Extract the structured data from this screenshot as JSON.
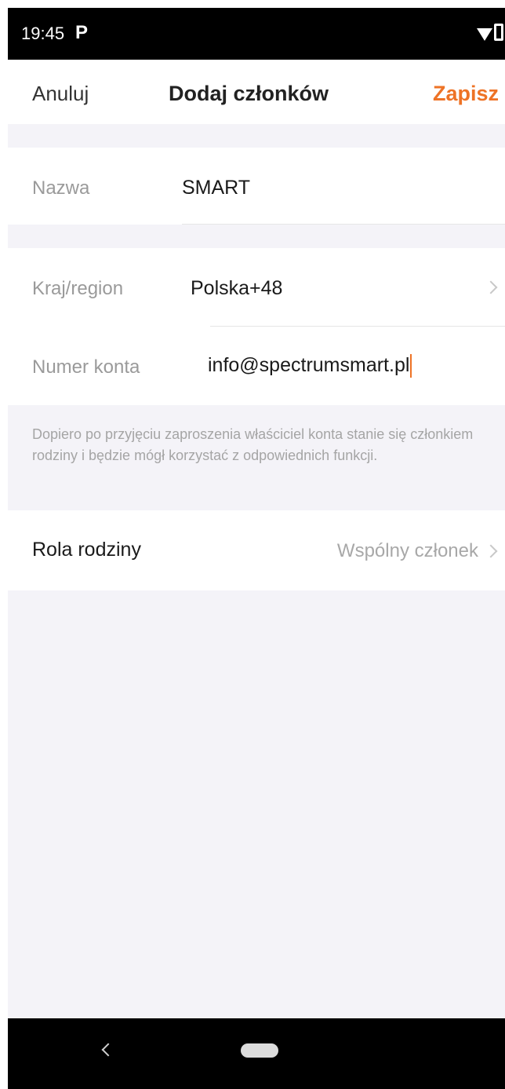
{
  "status_bar": {
    "time": "19:45",
    "notification_glyph": "P",
    "icons": [
      "parking-notification-icon",
      "wifi-icon",
      "battery-icon"
    ]
  },
  "header": {
    "cancel_label": "Anuluj",
    "title": "Dodaj członków",
    "save_label": "Zapisz"
  },
  "form": {
    "name": {
      "label": "Nazwa",
      "value": "SMART"
    },
    "region": {
      "label": "Kraj/region",
      "value": "Polska+48"
    },
    "account": {
      "label": "Numer konta",
      "value": "info@spectrumsmart.pl"
    }
  },
  "hint_text": "Dopiero po przyjęciu zaproszenia właściciel konta stanie się członkiem rodziny i będzie mógł korzystać z odpowiednich funkcji.",
  "role": {
    "label": "Rola rodziny",
    "value": "Wspólny członek"
  },
  "colors": {
    "accent": "#ee7326",
    "background": "#f4f3f8"
  }
}
